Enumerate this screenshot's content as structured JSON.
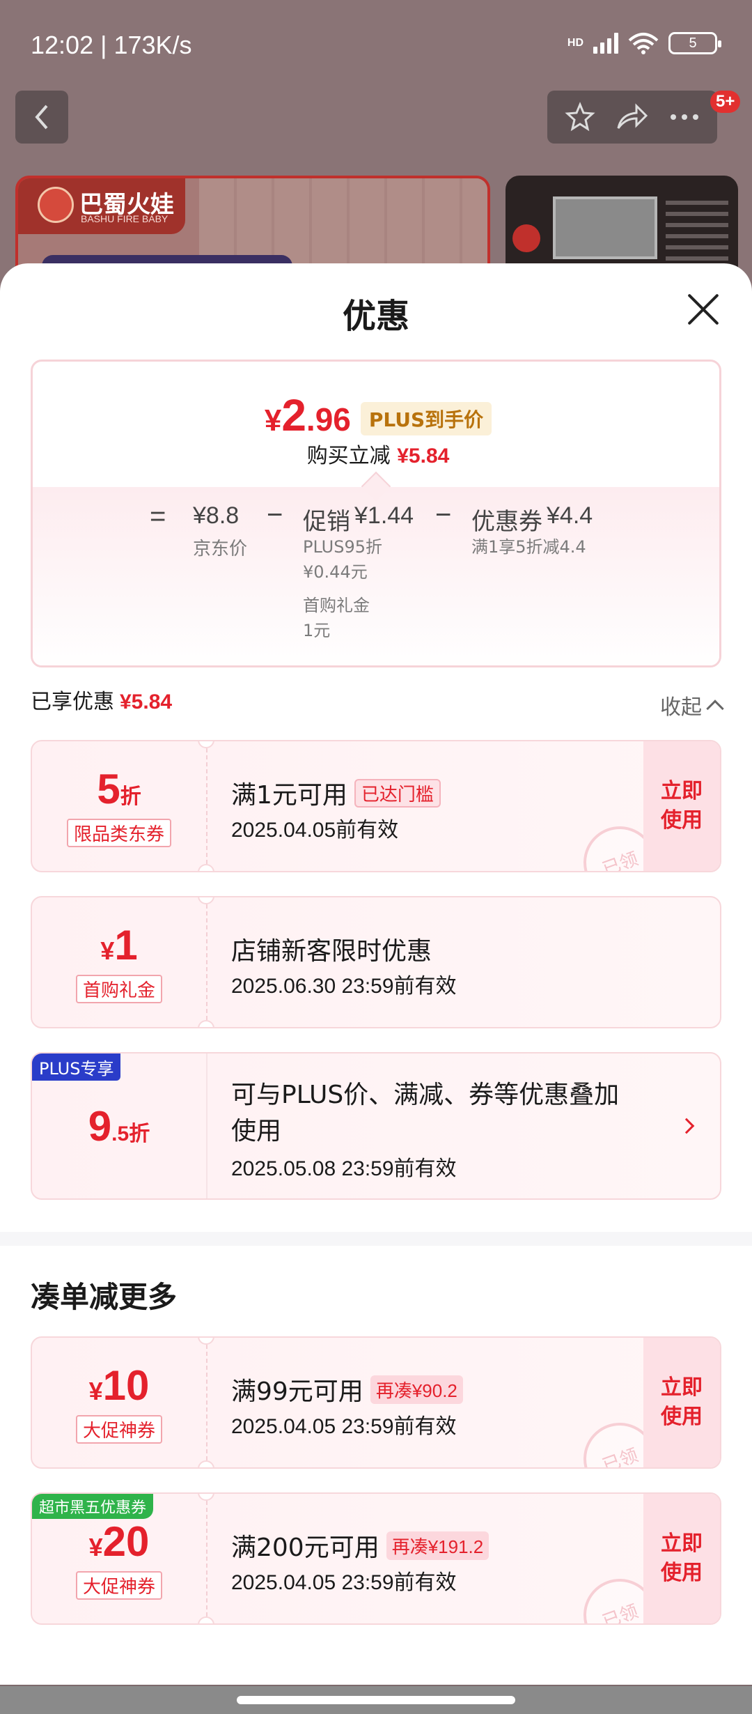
{
  "status_bar": {
    "time_speed": "12:02 | 173K/s",
    "network": "HD",
    "battery": "5"
  },
  "nav": {
    "badge": "5+",
    "icons": [
      "back-icon",
      "star-icon",
      "share-icon",
      "more-icon"
    ]
  },
  "product": {
    "brand_cn": "巴蜀火娃",
    "brand_en": "BASHU FIRE BABY"
  },
  "sheet": {
    "title": "优惠",
    "price": {
      "yen": "¥",
      "int": "2",
      "dec": ".96",
      "tag": "PLUS到手价",
      "reduce_label": "购买立减",
      "reduce_value": "¥5.84"
    },
    "breakdown": {
      "eq": "=",
      "minus": "−",
      "jd_price": "¥8.8",
      "jd_label": "京东价",
      "promo_label": "促销",
      "promo_value": "¥1.44",
      "promo_sub1": "PLUS95折",
      "promo_sub2": "¥0.44元",
      "promo_sub3": "首购礼金",
      "promo_sub4": "1元",
      "coupon_label": "优惠券",
      "coupon_value": "¥4.4",
      "coupon_sub": "满1享5折减4.4"
    },
    "enjoyed_label": "已享优惠",
    "enjoyed_value": "¥5.84",
    "collapse_label": "收起",
    "coupons": [
      {
        "big": "5",
        "unit": "折",
        "tag": "限品类东券",
        "title": "满1元可用",
        "pill": "已达门槛",
        "date": "2025.04.05前有效",
        "action": "立即使用",
        "stamp": "已领"
      },
      {
        "yen": "¥",
        "big": "1",
        "tag": "首购礼金",
        "title": "店铺新客限时优惠",
        "date": "2025.06.30 23:59前有效"
      },
      {
        "corner": "PLUS专享",
        "big": "9",
        "small": ".5折",
        "title_line1": "可与PLUS价、满减、券等优惠叠加",
        "title_line2": "使用",
        "date": "2025.05.08 23:59前有效"
      }
    ],
    "more_section_title": "凑单减更多",
    "more_coupons": [
      {
        "yen": "¥",
        "big": "10",
        "tag": "大促神券",
        "title": "满99元可用",
        "pill": "再凑¥90.2",
        "date": "2025.04.05 23:59前有效",
        "action": "立即使用",
        "stamp": "已领"
      },
      {
        "corner": "超市黑五优惠券",
        "yen": "¥",
        "big": "20",
        "tag": "大促神券",
        "title": "满200元可用",
        "pill": "再凑¥191.2",
        "date": "2025.04.05 23:59前有效",
        "action": "立即使用",
        "stamp": "已领"
      }
    ]
  },
  "colors": {
    "accent": "#e4212c",
    "plus_blue": "#2a3cc9",
    "supermarket_green": "#2fb34a",
    "plus_gold": "#b8720c"
  }
}
